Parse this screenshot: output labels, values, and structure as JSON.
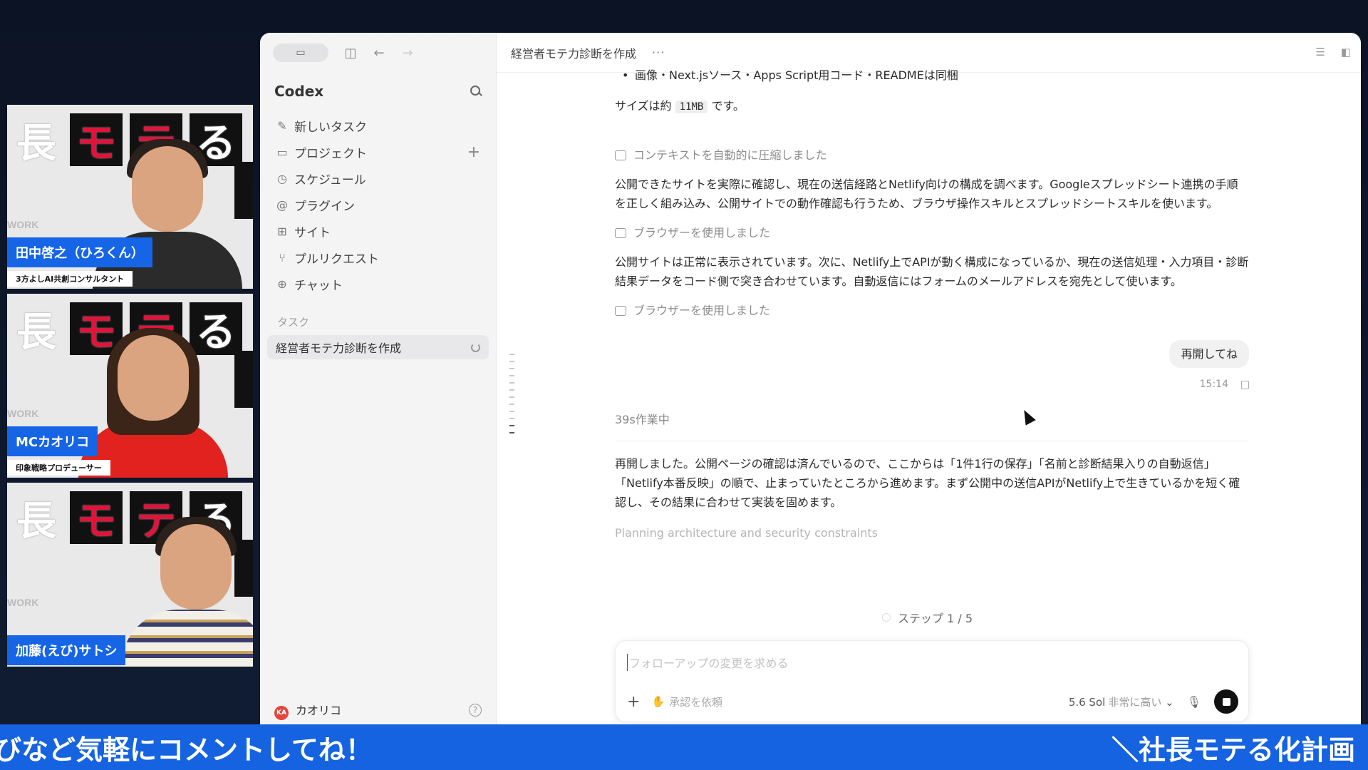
{
  "participants": [
    {
      "name": "田中啓之（ひろくん）",
      "role": "3方よしAI共創コンサルタント"
    },
    {
      "name": "MCカオリコ",
      "role": "印象戦略プロデューサー"
    },
    {
      "name": "加藤(えび)サトシ",
      "role": ""
    }
  ],
  "tile_background": {
    "chars": [
      "長",
      "モ",
      "テ",
      "る"
    ],
    "work": "WORK"
  },
  "sidebar": {
    "brand": "Codex",
    "items": [
      {
        "label": "新しいタスク",
        "icon": "edit-icon"
      },
      {
        "label": "プロジェクト",
        "icon": "folder-icon"
      },
      {
        "label": "スケジュール",
        "icon": "clock-icon"
      },
      {
        "label": "プラグイン",
        "icon": "at-icon"
      },
      {
        "label": "サイト",
        "icon": "grid-icon"
      },
      {
        "label": "プルリクエスト",
        "icon": "pull-request-icon"
      },
      {
        "label": "チャット",
        "icon": "plus-circle-icon"
      }
    ],
    "section_label": "タスク",
    "tasks": [
      {
        "label": "経営者モテ力診断を作成"
      }
    ],
    "footer": {
      "user": "カオリコ",
      "avatar_initials": "KA"
    }
  },
  "main": {
    "title": "経営者モテ力診断を作成",
    "more": "···",
    "bullet": "画像・Next.jsソース・Apps Script用コード・READMEは同梱",
    "size_prefix": "サイズは約",
    "size_value": "11MB",
    "size_suffix": "です。",
    "compressed_note": "コンテキストを自動的に圧縮しました",
    "para1": "公開できたサイトを実際に確認し、現在の送信経路とNetlify向けの構成を調べます。Googleスプレッドシート連携の手順を正しく組み込み、公開サイトでの動作確認も行うため、ブラウザ操作スキルとスプレッドシートスキルを使います。",
    "browser_note_1": "ブラウザーを使用しました",
    "para2": "公開サイトは正常に表示されています。次に、Netlify上でAPIが動く構成になっているか、現在の送信処理・入力項目・診断結果データをコード側で突き合わせています。自動返信にはフォームのメールアドレスを宛先として使います。",
    "browser_note_2": "ブラウザーを使用しました",
    "user_message": "再開してね",
    "user_message_time": "15:14",
    "working_status": "39s作業中",
    "para3": "再開しました。公開ページの確認は済んでいるので、ここからは「1件1行の保存」「名前と診断結果入りの自動返信」「Netlify本番反映」の順で、止まっていたところから進めます。まず公開中の送信APIがNetlify上で生きているかを短く確認し、その結果に合わせて実装を固めます。",
    "planning": "Planning architecture and security constraints",
    "step": "ステップ 1 / 5"
  },
  "composer": {
    "placeholder": "フォローアップの変更を求める",
    "approval": "承認を依頼",
    "model": "5.6 Sol",
    "effort": "非常に高い"
  },
  "ticker": {
    "left": "びなど気軽にコメントしてね！",
    "right": "＼社長モテる化計画"
  },
  "colors": {
    "accent": "#1563e0",
    "nameplate": "#1565e6",
    "brand_red": "#e2133b"
  }
}
